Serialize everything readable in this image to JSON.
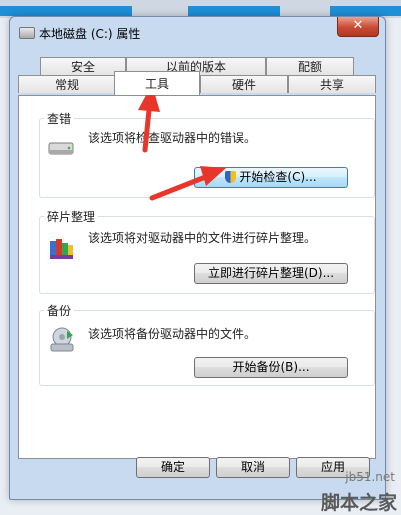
{
  "dialog": {
    "title": "本地磁盘 (C:) 属性",
    "close_label": "✕"
  },
  "tabs": {
    "row1": [
      "安全",
      "以前的版本",
      "配额"
    ],
    "row2": [
      "常规",
      "工具",
      "硬件",
      "共享"
    ],
    "active": "工具"
  },
  "groups": {
    "check": {
      "title": "查错",
      "desc": "该选项将检查驱动器中的错误。",
      "button": "开始检查(C)..."
    },
    "defrag": {
      "title": "碎片整理",
      "desc": "该选项将对驱动器中的文件进行碎片整理。",
      "button": "立即进行碎片整理(D)..."
    },
    "backup": {
      "title": "备份",
      "desc": "该选项将备份驱动器中的文件。",
      "button": "开始备份(B)..."
    }
  },
  "footer": {
    "ok": "确定",
    "cancel": "取消",
    "apply": "应用"
  },
  "watermark": {
    "site": "jb51.net",
    "brand": "脚本之家"
  },
  "colors": {
    "annotation": "#e8362a",
    "close": "#c84a33"
  }
}
